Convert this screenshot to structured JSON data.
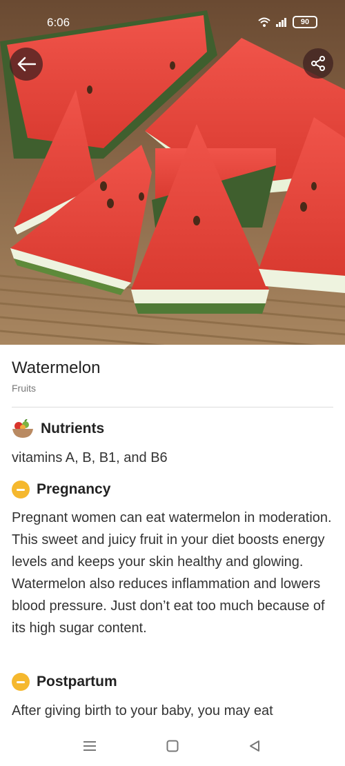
{
  "status": {
    "time": "6:06",
    "battery": "90"
  },
  "item": {
    "title": "Watermelon",
    "category": "Fruits"
  },
  "sections": {
    "nutrients": {
      "title": "Nutrients",
      "text": "vitamins A, B, B1, and B6",
      "icon": "fruit-bowl-icon"
    },
    "pregnancy": {
      "title": "Pregnancy",
      "text": "Pregnant women can eat watermelon in moderation. This sweet and juicy fruit in your diet boosts energy levels and keeps your skin healthy and glowing. Watermelon also reduces inflammation and lowers blood pressure. Just don’t eat too much because of its high sugar content.",
      "icon": "minus-circle-icon"
    },
    "postpartum": {
      "title": "Postpartum",
      "text": "After giving birth to your baby, you may eat",
      "icon": "minus-circle-icon"
    }
  },
  "colors": {
    "caution": "#f5b82e",
    "watermelon_red": "#e8433a",
    "rind_green": "#4f7a36"
  },
  "nav": {
    "icons": [
      "menu-icon",
      "home-square-icon",
      "back-triangle-icon"
    ]
  }
}
